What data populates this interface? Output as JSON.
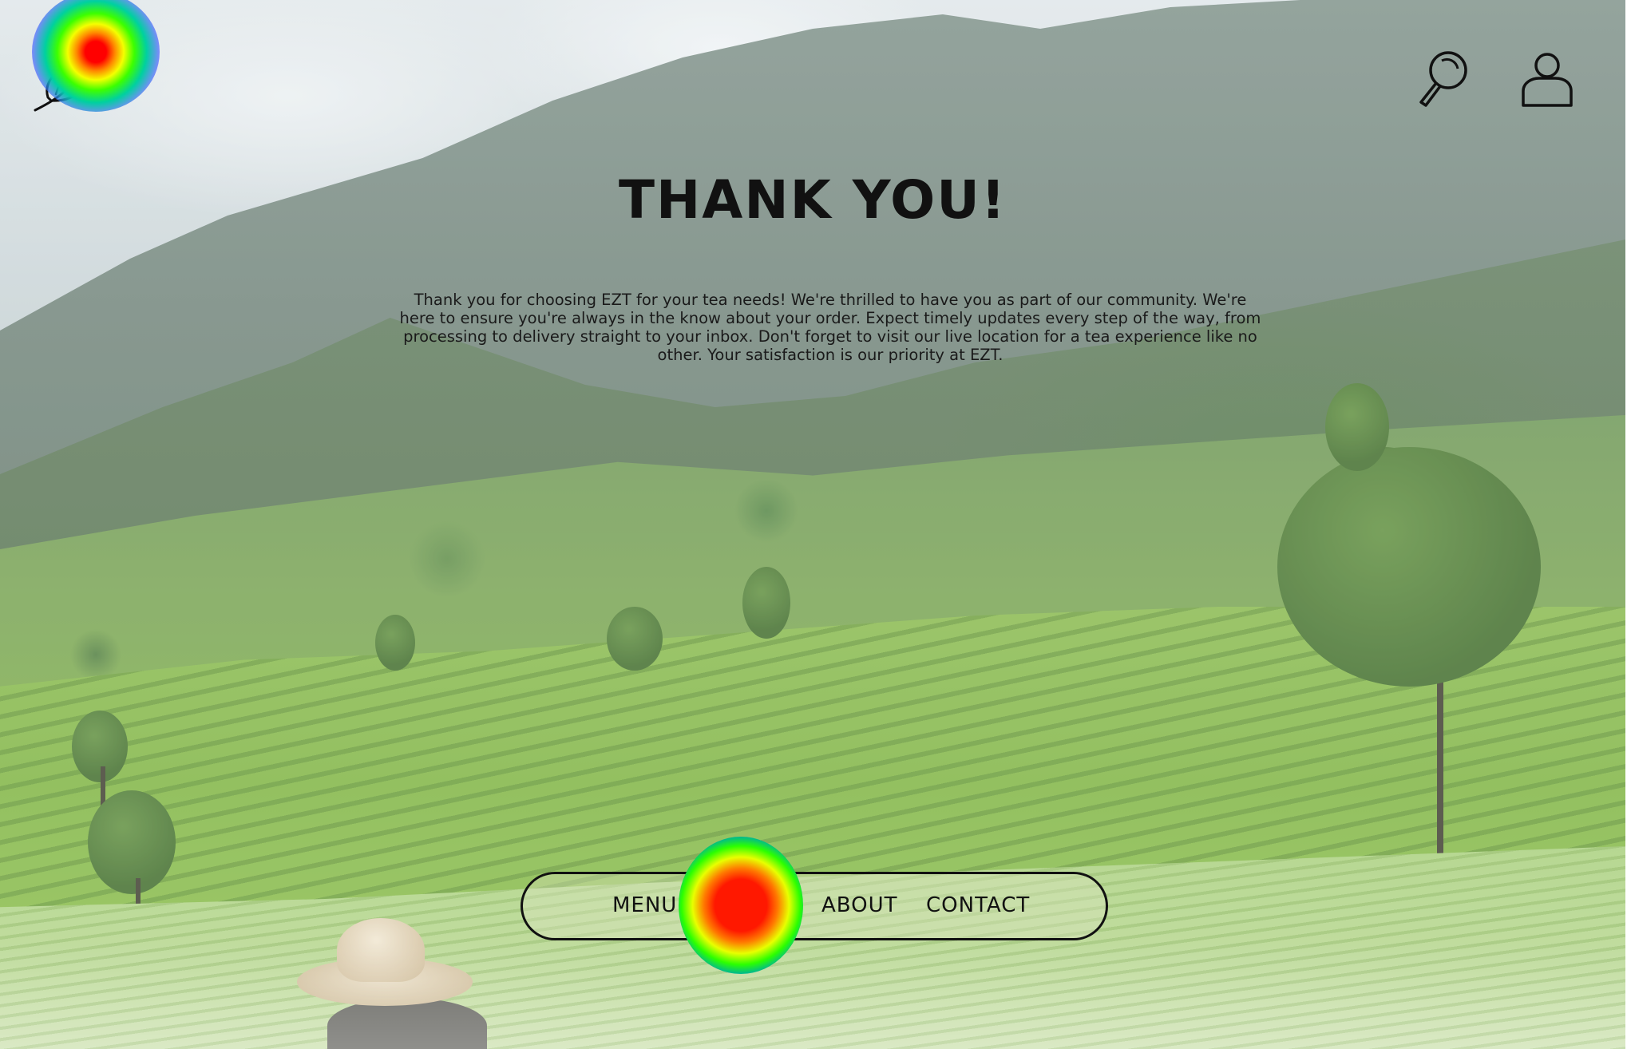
{
  "header": {
    "logo_icon": "tea-leaf-icon",
    "search_icon": "search-icon",
    "account_icon": "user-icon"
  },
  "main": {
    "title": "THANK YOU!",
    "message": "Thank you for choosing EZT for your tea needs! We're thrilled to have you as part of our community. We're here to ensure you're always in the know about your order. Expect timely updates every step of the way, from processing to delivery straight to your inbox. Don't forget to visit our live location for a tea experience like no other. Your satisfaction is our priority at EZT."
  },
  "nav": {
    "menu": "MENU",
    "about": "ABOUT",
    "contact": "CONTACT"
  },
  "colors": {
    "text": "#111111",
    "heat_hot": "#ff0000",
    "heat_mid": "#f4ff00",
    "heat_cool": "#3c5aff"
  }
}
